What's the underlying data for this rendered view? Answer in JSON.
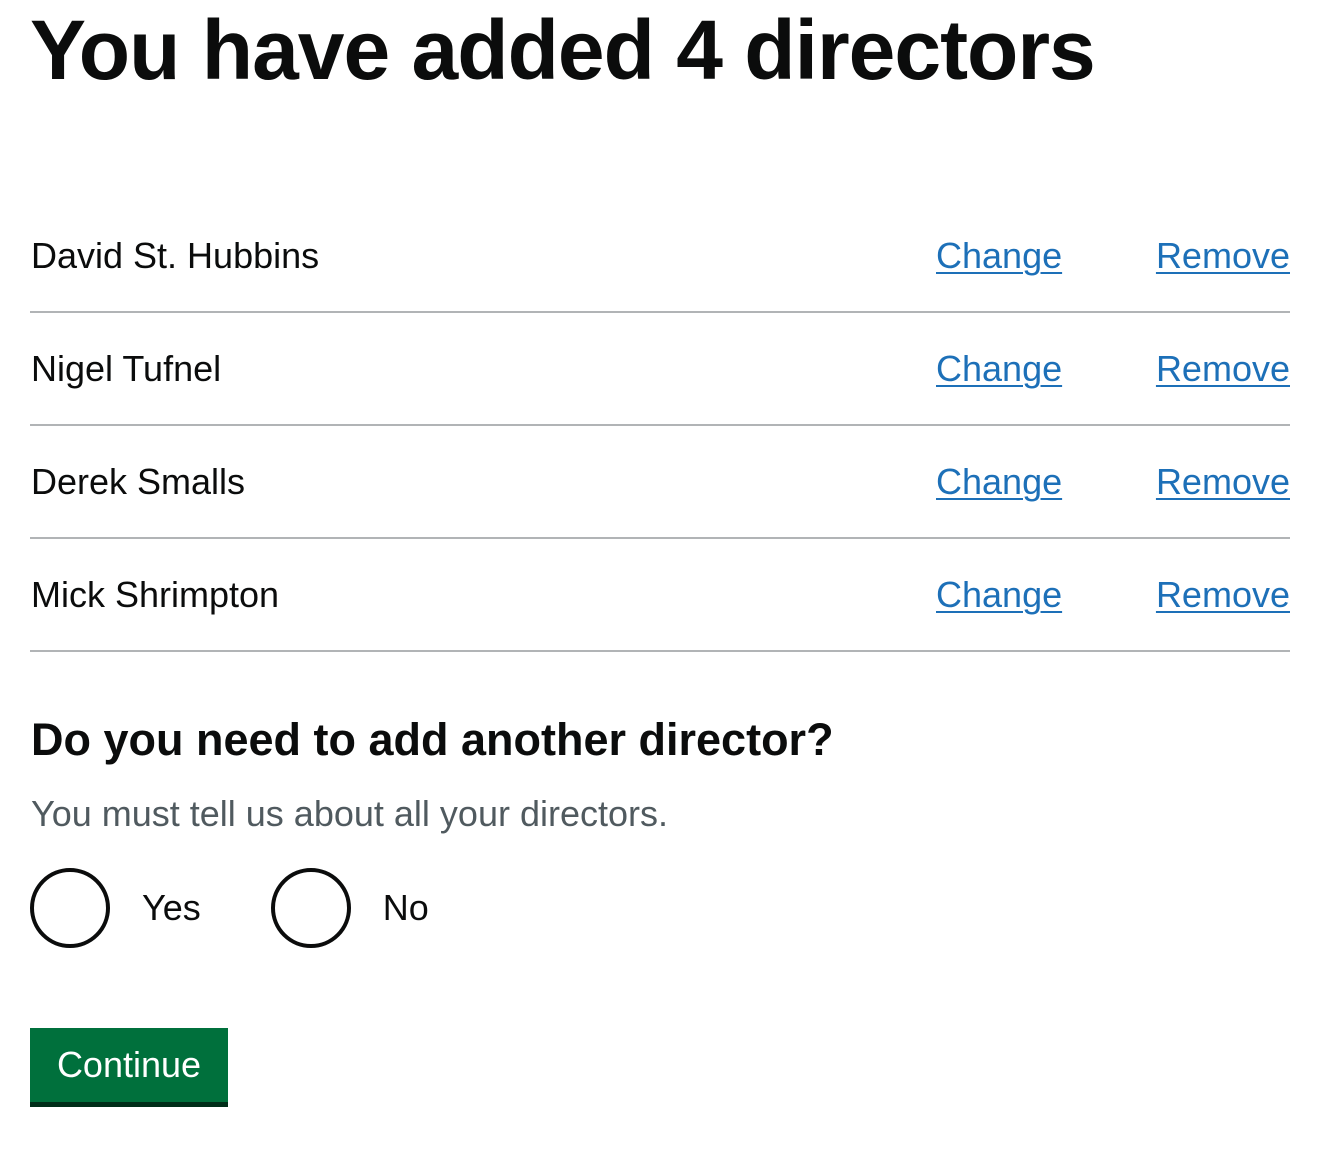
{
  "heading": "You have added 4 directors",
  "directors": [
    {
      "name": "David St. Hubbins",
      "change_label": "Change",
      "remove_label": "Remove"
    },
    {
      "name": "Nigel Tufnel",
      "change_label": "Change",
      "remove_label": "Remove"
    },
    {
      "name": "Derek Smalls",
      "change_label": "Change",
      "remove_label": "Remove"
    },
    {
      "name": "Mick Shrimpton",
      "change_label": "Change",
      "remove_label": "Remove"
    }
  ],
  "question": {
    "title": "Do you need to add another director?",
    "hint": "You must tell us about all your directors.",
    "options": [
      "Yes",
      "No"
    ],
    "selected": null
  },
  "continue_label": "Continue",
  "colors": {
    "text": "#0b0c0c",
    "link": "#1d70b8",
    "hint": "#505a5f",
    "border": "#b1b4b6",
    "button": "#00703c",
    "button_shadow": "#002d18"
  }
}
